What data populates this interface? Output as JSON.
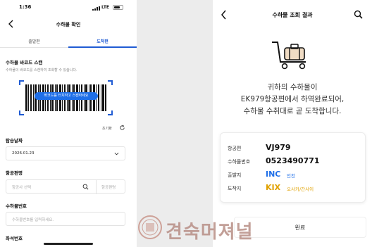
{
  "left_screen": {
    "status_bar": {
      "time": "1:36",
      "network": "LTE"
    },
    "header": {
      "title": "수하물 확인"
    },
    "tabs": [
      {
        "label": "출발편"
      },
      {
        "label": "도착편"
      }
    ],
    "active_tab": 1,
    "barcode_section": {
      "title": "수하물 바코드 스캔",
      "description": "수하물의 바코드를 스캔하여 조회할 수 있습니다.",
      "scan_button_label": "바코드를 터치하고 스캔하세요"
    },
    "reset_label": "초기화",
    "boarding_date": {
      "label": "탑승날짜",
      "value": "2026.01.23"
    },
    "flight": {
      "label": "항공편명",
      "airline_placeholder": "항공사 선택",
      "flight_placeholder": "항공편명"
    },
    "baggage_number": {
      "label": "수하물번호",
      "placeholder": "수하물번호를 입력하세요."
    },
    "next_section_label": "좌석번호"
  },
  "right_screen": {
    "header": {
      "title": "수하물 조회 결과"
    },
    "message_lines": [
      "귀하의 수하물이",
      "EK979항공편에서 하역완료되어,",
      "수하물 수취대로 곧 도착합니다."
    ],
    "details": {
      "flight": {
        "label": "항공편",
        "value": "VJ979"
      },
      "baggage_no": {
        "label": "수하물번호",
        "value": "0523490771"
      },
      "departure": {
        "label": "출발지",
        "code": "INC",
        "city": "인천",
        "color": "#1f6fe8"
      },
      "arrival": {
        "label": "도착지",
        "code": "KIX",
        "city": "오사카/간사이",
        "color": "#e0a100"
      }
    },
    "done_button": "완료"
  },
  "watermark": {
    "text": "견숙머져널"
  },
  "colors": {
    "accent": "#1f5bd3",
    "scan_button": "#1f6fe8"
  }
}
